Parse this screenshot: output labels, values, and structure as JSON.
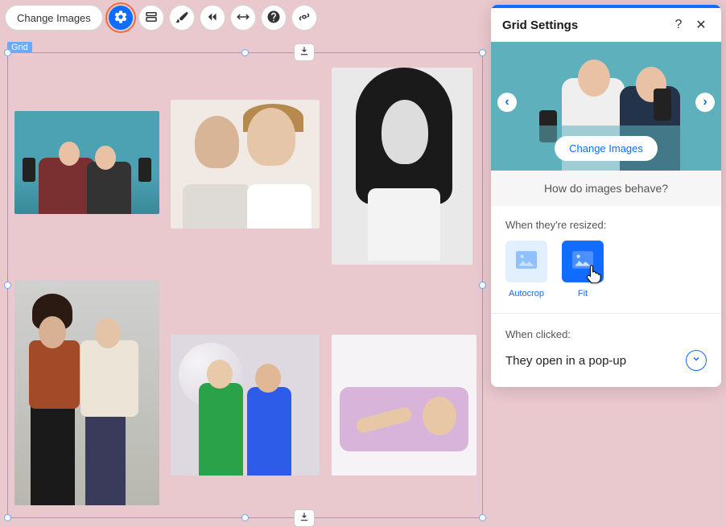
{
  "toolbar": {
    "change_images_label": "Change Images"
  },
  "canvas": {
    "selection_label": "Grid"
  },
  "panel": {
    "title": "Grid Settings",
    "help_glyph": "?",
    "close_glyph": "✕",
    "hero_change_label": "Change Images",
    "section_question": "How do images behave?",
    "resize_label": "When they're resized:",
    "options": {
      "autocrop": "Autocrop",
      "fit": "Fit"
    },
    "click_label": "When clicked:",
    "click_value": "They open in a pop-up"
  }
}
